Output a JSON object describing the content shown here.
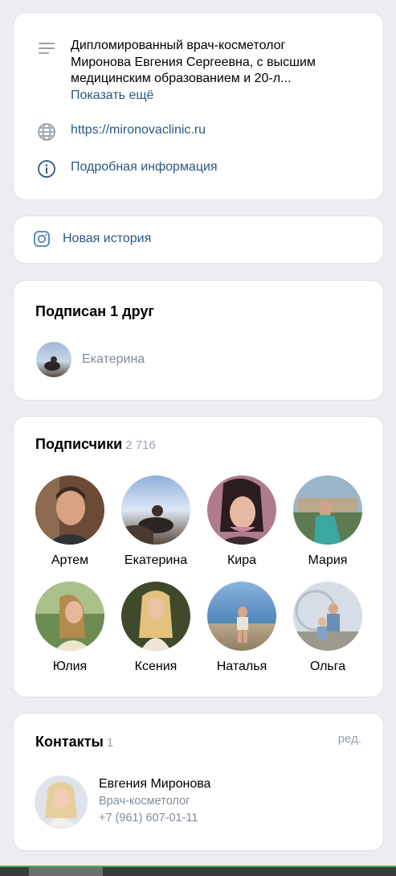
{
  "info": {
    "description_lines": [
      "Дипломированный врач-косметолог",
      "Миронова Евгения Сергеевна, с высшим",
      "медицинским образованием и 20-л..."
    ],
    "show_more": "Показать ещё",
    "website": "https://mironovaclinic.ru",
    "details": "Подробная информация",
    "icons": {
      "description": "lines-icon",
      "website": "globe-icon",
      "details": "info-icon"
    }
  },
  "story": {
    "label": "Новая история",
    "icon": "instagram-icon"
  },
  "friends": {
    "title": "Подписан 1 друг",
    "items": [
      {
        "name": "Екатерина"
      }
    ]
  },
  "followers": {
    "title": "Подписчики",
    "count": "2 716",
    "items": [
      {
        "name": "Артем"
      },
      {
        "name": "Екатерина"
      },
      {
        "name": "Кира"
      },
      {
        "name": "Мария"
      },
      {
        "name": "Юлия"
      },
      {
        "name": "Ксения"
      },
      {
        "name": "Наталья"
      },
      {
        "name": "Ольга"
      }
    ]
  },
  "contacts": {
    "title": "Контакты",
    "count": "1",
    "edit_label": "ред.",
    "items": [
      {
        "name": "Евгения Миронова",
        "role": "Врач-косметолог",
        "phone": "+7 (961) 607-01-11"
      }
    ]
  },
  "colors": {
    "link": "#2a5885",
    "muted": "#818c99",
    "background": "#ebedf0",
    "accent": "#4bb34b"
  }
}
